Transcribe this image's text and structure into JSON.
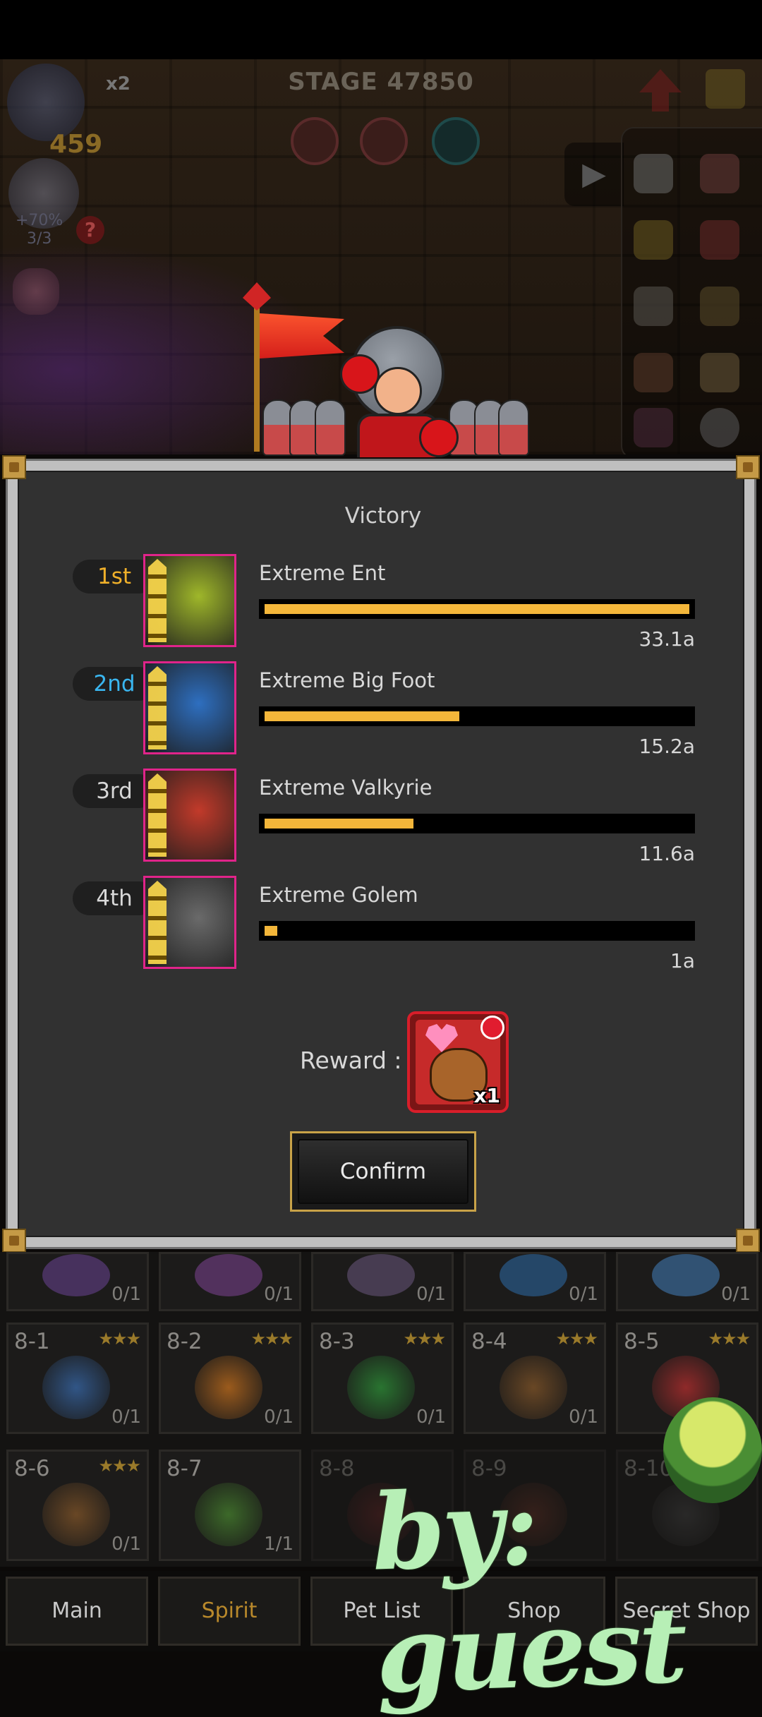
{
  "hud": {
    "speed": "x2",
    "boss_level": "459",
    "stage": "STAGE 47850",
    "hero_percent": "+70%",
    "hero_count": "3/3",
    "help_glyph": "?",
    "play_glyph": "▶"
  },
  "dialog": {
    "title": "Victory",
    "ranking": [
      {
        "rank": "1st",
        "name": "Extreme Ent",
        "damage": "33.1a",
        "progress": 1.0,
        "rank_color": "#f0b02a",
        "portrait_color": "#9fb72a"
      },
      {
        "rank": "2nd",
        "name": "Extreme Big Foot",
        "damage": "15.2a",
        "progress": 0.459,
        "rank_color": "#3ab6f0",
        "portrait_color": "#2e6fc0"
      },
      {
        "rank": "3rd",
        "name": "Extreme Valkyrie",
        "damage": "11.6a",
        "progress": 0.35,
        "rank_color": "#d8d8d8",
        "portrait_color": "#c23a2a"
      },
      {
        "rank": "4th",
        "name": "Extreme Golem",
        "damage": "1a",
        "progress": 0.03,
        "rank_color": "#d8d8d8",
        "portrait_color": "#6a6a6a"
      }
    ],
    "reward_label": "Reward :",
    "reward_quantity": "x1",
    "confirm_label": "Confirm"
  },
  "pet_grid": {
    "top_row_counts": [
      "0/1",
      "0/1",
      "0/1",
      "0/1",
      "0/1"
    ],
    "rows": [
      [
        {
          "id": "8-1",
          "stars": "★★★",
          "count": "0/1",
          "color": "#3a6fb5"
        },
        {
          "id": "8-2",
          "stars": "★★★",
          "count": "0/1",
          "color": "#d1761e"
        },
        {
          "id": "8-3",
          "stars": "★★★",
          "count": "0/1",
          "color": "#2f9a3a"
        },
        {
          "id": "8-4",
          "stars": "★★★",
          "count": "0/1",
          "color": "#8a5a2a"
        },
        {
          "id": "8-5",
          "stars": "★★★",
          "count": "",
          "color": "#c03030"
        }
      ],
      [
        {
          "id": "8-6",
          "stars": "★★★",
          "count": "0/1",
          "color": "#8a5a2a"
        },
        {
          "id": "8-7",
          "stars": "",
          "count": "1/1",
          "color": "#4a8a30"
        },
        {
          "id": "8-8",
          "stars": "",
          "count": "",
          "color": "#7a2a2a"
        },
        {
          "id": "8-9",
          "stars": "",
          "count": "",
          "color": "#7a3a2a"
        },
        {
          "id": "8-10",
          "stars": "",
          "count": "",
          "color": "#555555"
        }
      ]
    ]
  },
  "nav": [
    {
      "label": "Main",
      "active": false
    },
    {
      "label": "Spirit",
      "active": true
    },
    {
      "label": "Pet List",
      "active": false
    },
    {
      "label": "Shop",
      "active": false
    },
    {
      "label": "Secret Shop",
      "active": false
    }
  ],
  "watermark": "by: guest"
}
